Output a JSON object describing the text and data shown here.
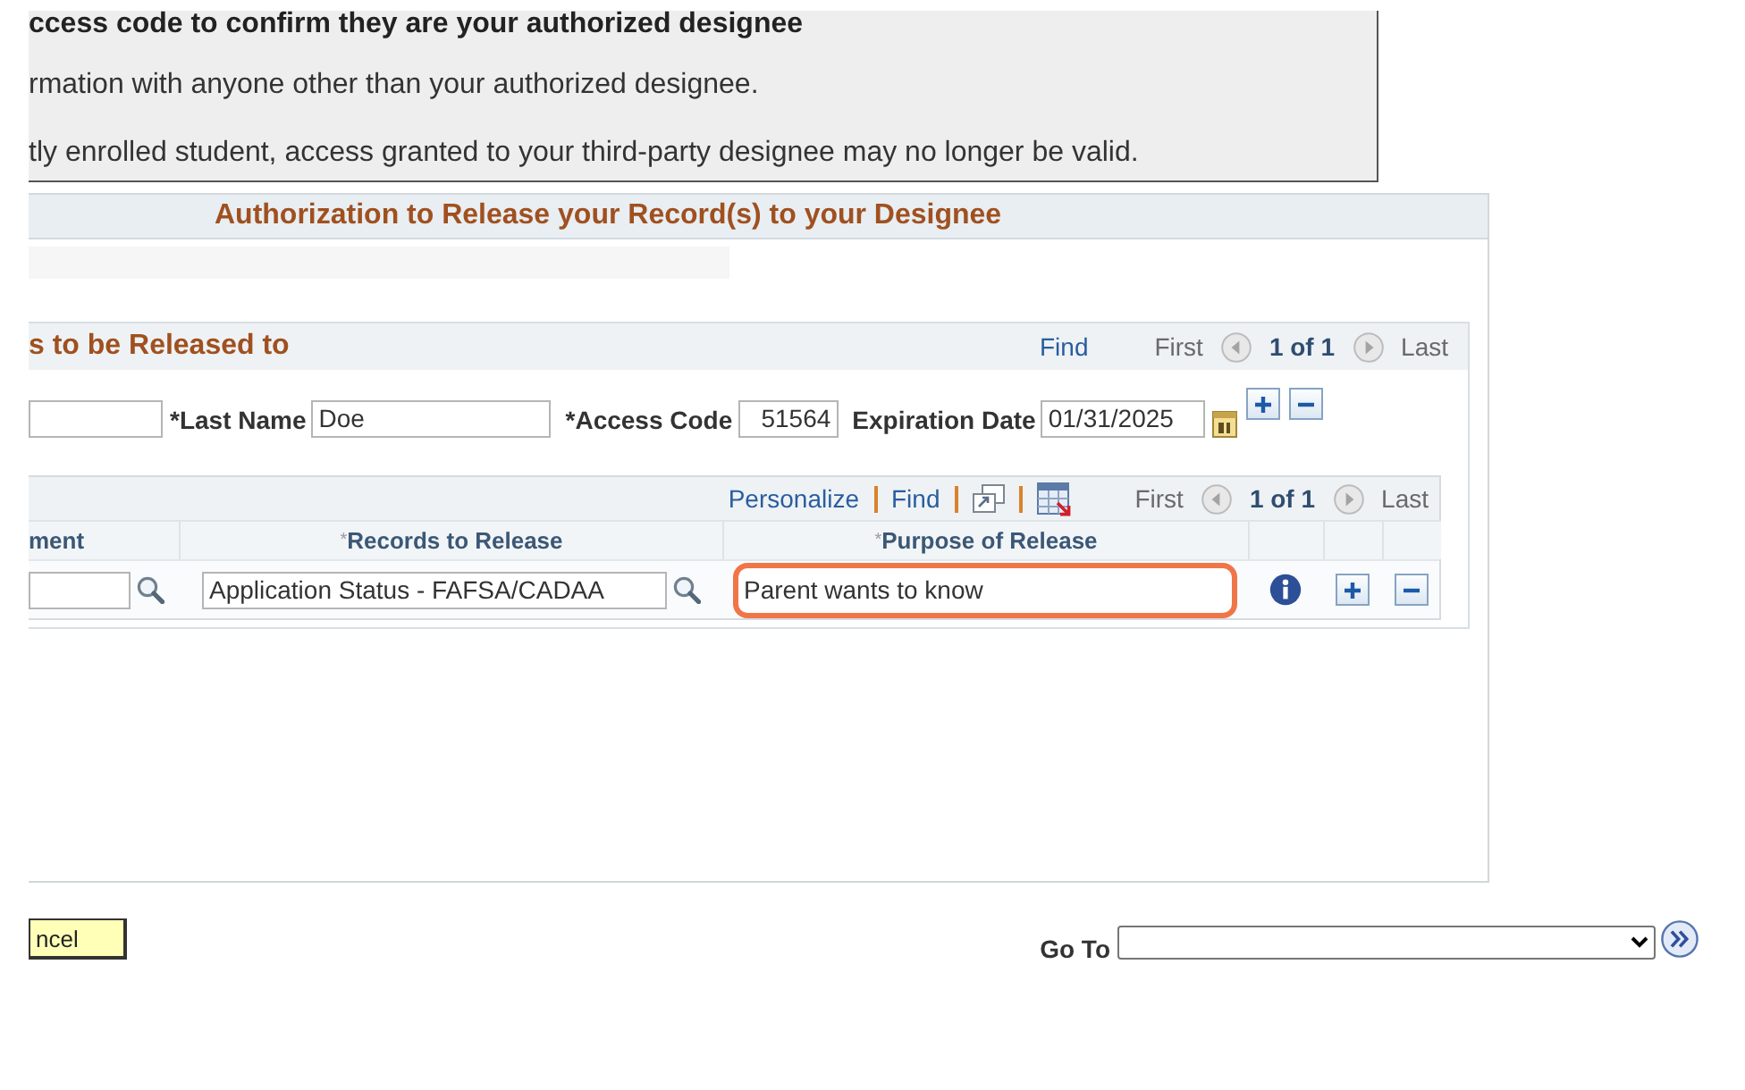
{
  "notice": {
    "lines": [
      {
        "kind": "heading",
        "text": "ccess code to confirm they are your authorized designee"
      },
      {
        "kind": "body",
        "text": "rmation with anyone other than your authorized designee."
      },
      {
        "kind": "body",
        "text": "tly enrolled student, access granted to your third-party designee may no longer be valid."
      }
    ]
  },
  "panel": {
    "title": "Authorization to Release your Record(s) to your Designee",
    "designees": {
      "title": "s to be Released to",
      "nav": {
        "find": "Find",
        "first": "First",
        "prev": {
          "disabled": true
        },
        "count": "1 of 1",
        "next": {
          "disabled": true
        },
        "last": "Last"
      },
      "fields": [
        {
          "kind": "text"
        },
        {
          "kind": "text",
          "label": "*Last Name",
          "value": "Doe"
        },
        {
          "kind": "number",
          "label": "*Access Code",
          "value": "51564"
        },
        {
          "kind": "date",
          "label": "Expiration Date",
          "value": "01/31/2025"
        }
      ],
      "records": {
        "toolbar": {
          "personalize": "Personalize",
          "find": "Find",
          "first": "First",
          "prev": {
            "disabled": true
          },
          "count": "1 of 1",
          "next": {
            "disabled": true
          },
          "last": "Last"
        },
        "columns": [
          "ment",
          "$^{*}$Records to Release",
          "$^{*}$Purpose of Release"
        ],
        "rows": [
          {
            "cells": [
              {
                "kind": "lookup"
              },
              {
                "kind": "lookup",
                "value": "Application Status - FAFSA/CADAA"
              },
              {
                "kind": "text",
                "value": "Parent wants to know",
                "highlighted": true
              }
            ]
          }
        ]
      }
    }
  },
  "footer": {
    "buttons": [
      {
        "label": "ncel"
      }
    ],
    "goto": {
      "label": "Go To"
    }
  }
}
